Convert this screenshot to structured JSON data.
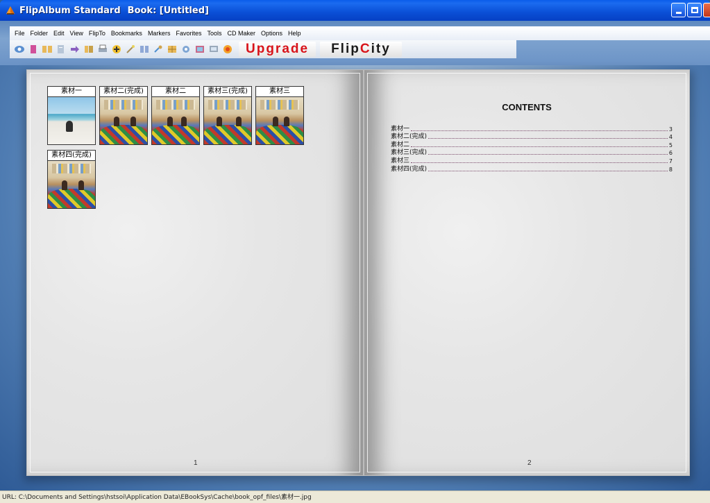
{
  "window": {
    "app_name": "FlipAlbum Standard",
    "document_title": "Book: [Untitled]"
  },
  "menu": {
    "items": [
      "File",
      "Folder",
      "Edit",
      "View",
      "FlipTo",
      "Bookmarks",
      "Markers",
      "Favorites",
      "Tools",
      "CD Maker",
      "Options",
      "Help"
    ]
  },
  "toolbar": {
    "icons": [
      "view-icon",
      "bookmark-icon",
      "album-icon",
      "page-icon",
      "arrow-icon",
      "flip-icon",
      "print-icon",
      "add-icon",
      "magic-icon",
      "split-icon",
      "tools-icon",
      "grid-icon",
      "search-icon",
      "frame-icon",
      "screen-icon",
      "flame-icon"
    ],
    "upgrade_label": "Upgrade",
    "flipcity_prefix": "Flip",
    "flipcity_c": "C",
    "flipcity_suffix": "ity"
  },
  "left_page": {
    "page_number": "1",
    "thumbnails": [
      {
        "caption": "素材一",
        "image": "beach"
      },
      {
        "caption": "素材二(完成)",
        "image": "classroom"
      },
      {
        "caption": "素材二",
        "image": "classroom"
      },
      {
        "caption": "素材三(完成)",
        "image": "classroom"
      },
      {
        "caption": "素材三",
        "image": "classroom"
      },
      {
        "caption": "素材四(完成)",
        "image": "classroom"
      }
    ]
  },
  "right_page": {
    "page_number": "2",
    "contents_title": "CONTENTS",
    "toc": [
      {
        "label": "素材一",
        "page": "3"
      },
      {
        "label": "素材二(完成)",
        "page": "4"
      },
      {
        "label": "素材二",
        "page": "5"
      },
      {
        "label": "素材三(完成)",
        "page": "6"
      },
      {
        "label": "素材三",
        "page": "7"
      },
      {
        "label": "素材四(完成)",
        "page": "8"
      }
    ]
  },
  "status_bar": {
    "text": "URL: C:\\Documents and Settings\\hstsoi\\Application Data\\EBookSys\\Cache\\book_opf_files\\素材一.jpg"
  },
  "colors": {
    "title_bar": "#0a4fd6",
    "upgrade_red": "#d8131a"
  }
}
